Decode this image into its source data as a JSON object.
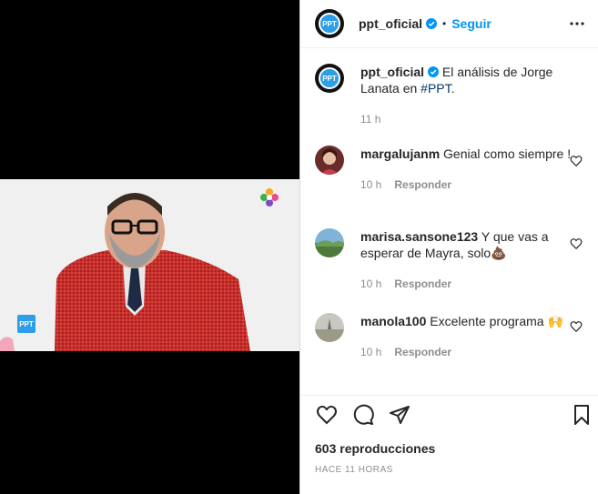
{
  "post": {
    "username": "ppt_oficial",
    "follow_label": "Seguir",
    "dot": "•",
    "avatar_text": "PPT",
    "caption_text": "El análisis de Jorge Lanata en ",
    "caption_hashtag": "#PPT",
    "caption_end": ".",
    "caption_time": "11 h"
  },
  "video": {
    "badge_text": "PPT"
  },
  "comments": [
    {
      "username": "margalujanm",
      "text": "Genial como siempre !",
      "time": "10 h",
      "reply": "Responder"
    },
    {
      "username": "marisa.sansone123",
      "text": "Y que vas a esperar de Mayra, solo💩",
      "time": "10 h",
      "reply": "Responder"
    },
    {
      "username": "manola100",
      "text": "Excelente programa 🙌",
      "time": "10 h",
      "reply": "Responder"
    }
  ],
  "footer": {
    "views": "603 reproducciones",
    "timestamp": "HACE 11 HORAS"
  },
  "colors": {
    "accent": "#0095f6",
    "hashtag": "#00376b",
    "muted": "#8e8e8e",
    "ppt_blue": "#2e9ee6"
  }
}
